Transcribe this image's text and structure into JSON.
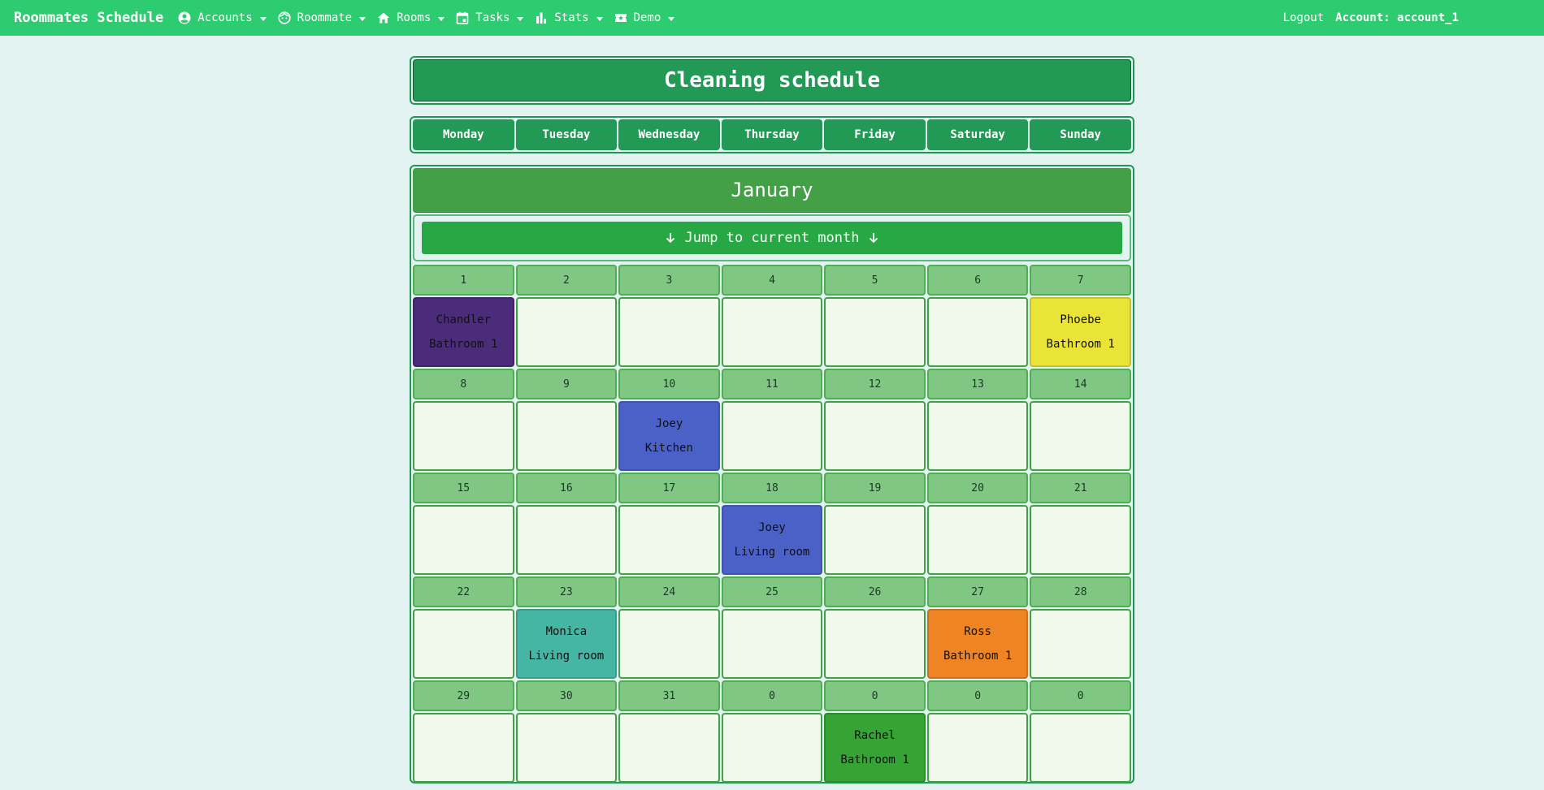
{
  "nav": {
    "brand": "Roommates Schedule",
    "items": [
      {
        "label": "Accounts",
        "icon": "account-circle-icon"
      },
      {
        "label": "Roommate",
        "icon": "face-icon"
      },
      {
        "label": "Rooms",
        "icon": "home-icon"
      },
      {
        "label": "Tasks",
        "icon": "calendar-icon"
      },
      {
        "label": "Stats",
        "icon": "bar-chart-icon"
      },
      {
        "label": "Demo",
        "icon": "ticket-icon"
      }
    ],
    "logout": "Logout",
    "account": "Account: account_1"
  },
  "page": {
    "title": "Cleaning schedule",
    "days": [
      "Monday",
      "Tuesday",
      "Wednesday",
      "Thursday",
      "Friday",
      "Saturday",
      "Sunday"
    ],
    "month": "January",
    "jump_label": "Jump to current month"
  },
  "calendar": {
    "weeks": [
      {
        "dates": [
          "1",
          "2",
          "3",
          "4",
          "5",
          "6",
          "7"
        ],
        "cells": [
          {
            "name": "Chandler",
            "room": "Bathroom 1",
            "color": "#4a2c7a"
          },
          null,
          null,
          null,
          null,
          null,
          {
            "name": "Phoebe",
            "room": "Bathroom 1",
            "color": "#eae436"
          }
        ]
      },
      {
        "dates": [
          "8",
          "9",
          "10",
          "11",
          "12",
          "13",
          "14"
        ],
        "cells": [
          null,
          null,
          {
            "name": "Joey",
            "room": "Kitchen",
            "color": "#4a62c8"
          },
          null,
          null,
          null,
          null
        ]
      },
      {
        "dates": [
          "15",
          "16",
          "17",
          "18",
          "19",
          "20",
          "21"
        ],
        "cells": [
          null,
          null,
          null,
          {
            "name": "Joey",
            "room": "Living room",
            "color": "#4a62c8"
          },
          null,
          null,
          null
        ]
      },
      {
        "dates": [
          "22",
          "23",
          "24",
          "25",
          "26",
          "27",
          "28"
        ],
        "cells": [
          null,
          {
            "name": "Monica",
            "room": "Living room",
            "color": "#46b6a4"
          },
          null,
          null,
          null,
          {
            "name": "Ross",
            "room": "Bathroom 1",
            "color": "#ef8424"
          },
          null
        ]
      },
      {
        "dates": [
          "29",
          "30",
          "31",
          "0",
          "0",
          "0",
          "0"
        ],
        "cells": [
          null,
          null,
          null,
          null,
          {
            "name": "Rachel",
            "room": "Bathroom 1",
            "color": "#36a335"
          },
          null,
          null
        ]
      }
    ]
  }
}
